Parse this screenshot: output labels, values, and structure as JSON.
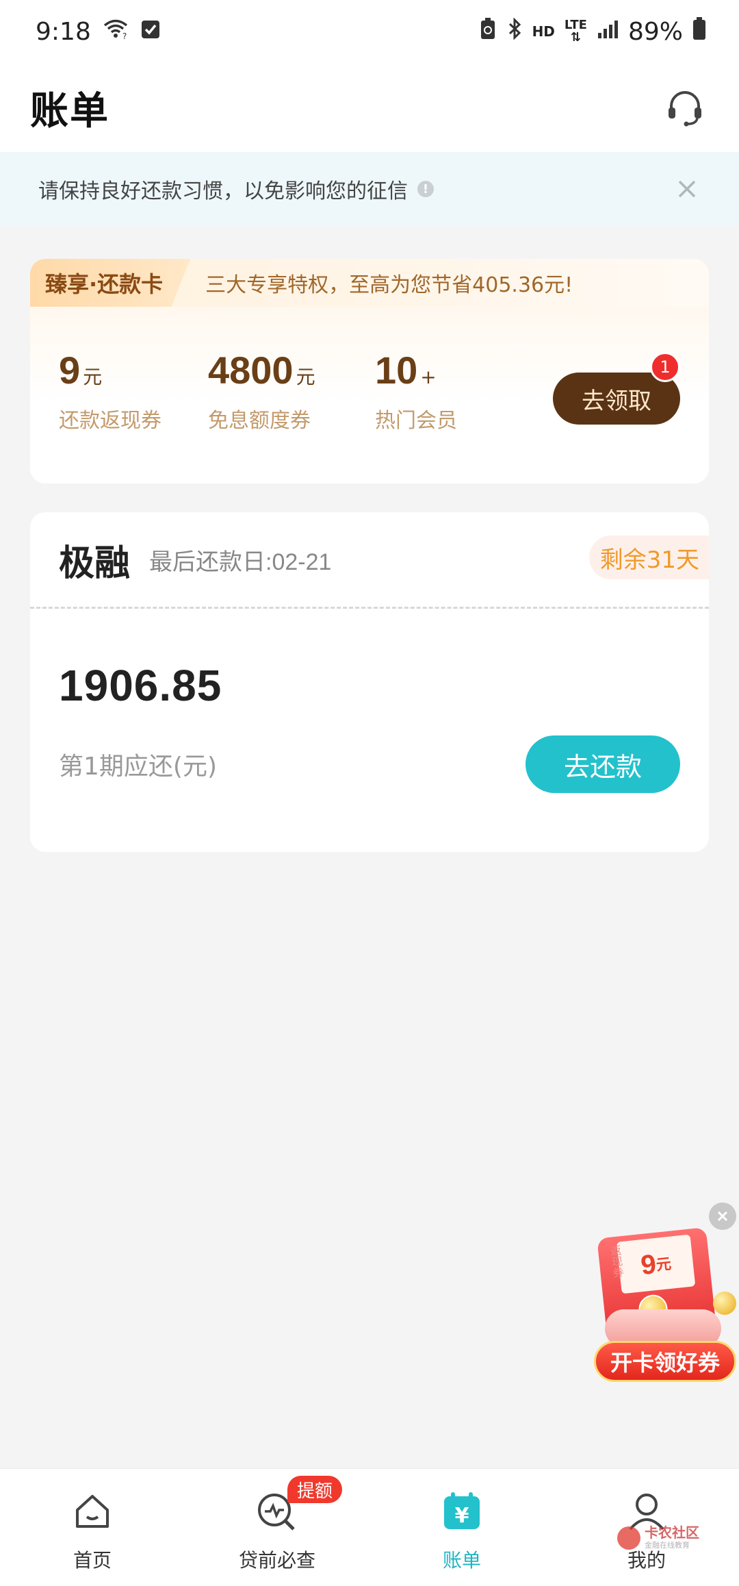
{
  "status_bar": {
    "time": "9:18",
    "network": "HD",
    "lte": "LTE",
    "battery": "89%",
    "icons": [
      "wifi-icon",
      "checkbox-notification-icon",
      "battery-saver-icon",
      "bluetooth-icon",
      "signal-icon",
      "battery-icon"
    ]
  },
  "header": {
    "title": "账单",
    "support_icon": "headset-icon"
  },
  "notice": {
    "text": "请保持良好还款习惯，以免影响您的征信",
    "info_icon": "info-icon",
    "close_icon": "close-icon"
  },
  "promo": {
    "tag": "臻享·还款卡",
    "slogan": "三大专享特权，至高为您节省405.36元!",
    "benefits": [
      {
        "value": "9",
        "unit": "元",
        "label": "还款返现券"
      },
      {
        "value": "4800",
        "unit": "元",
        "label": "免息额度券"
      },
      {
        "value": "10",
        "unit": "+",
        "label": "热门会员"
      }
    ],
    "claim_label": "去领取",
    "claim_badge": "1"
  },
  "bill": {
    "lender": "极融",
    "due_date": "最后还款日:02-21",
    "remaining": "剩余31天",
    "amount": "1906.85",
    "amount_label": "第1期应还(元)",
    "repay_label": "去还款"
  },
  "float_ad": {
    "side_text": "返现券",
    "value": "9",
    "unit": "元",
    "cta": "开卡领好券"
  },
  "bottom_nav": {
    "items": [
      {
        "label": "首页",
        "icon": "home-icon",
        "active": false
      },
      {
        "label": "贷前必查",
        "icon": "credit-check-icon",
        "active": false,
        "badge": "提额"
      },
      {
        "label": "账单",
        "icon": "bill-icon",
        "active": true
      },
      {
        "label": "我的",
        "icon": "profile-icon",
        "active": false
      }
    ]
  },
  "watermark": {
    "title": "卡农社区",
    "subtitle": "金融在线教育"
  },
  "colors": {
    "accent": "#22c1cc",
    "promo_brown": "#5a3314",
    "remaining_orange": "#f09a2a",
    "badge_red": "#f0392c"
  }
}
